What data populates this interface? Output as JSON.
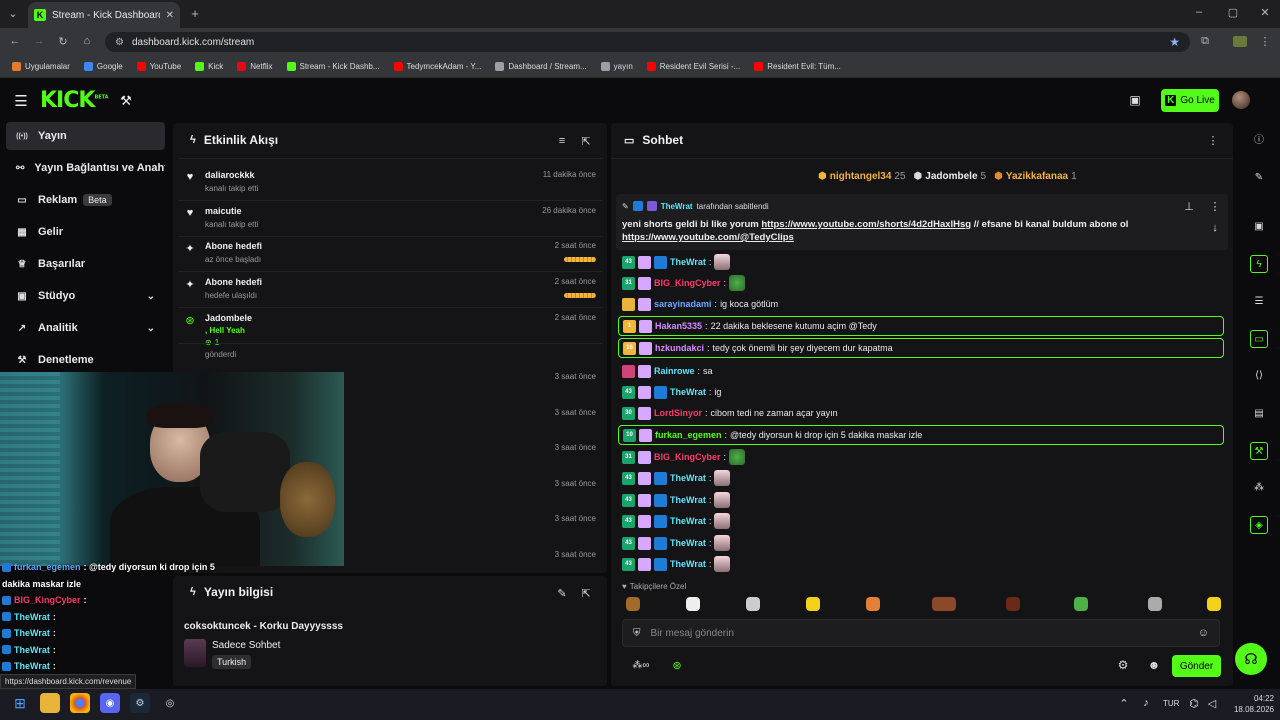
{
  "browser": {
    "tab_title": "Stream - Kick Dashboard",
    "url": "dashboard.kick.com/stream",
    "status_url": "https://dashboard.kick.com/revenue",
    "bookmarks": [
      {
        "label": "Uygulamalar",
        "color": "#e57c2c"
      },
      {
        "label": "Google",
        "color": "#4285f4"
      },
      {
        "label": "YouTube",
        "color": "#ff0000"
      },
      {
        "label": "Kick",
        "color": "#53fc18"
      },
      {
        "label": "Netflix",
        "color": "#e50914"
      },
      {
        "label": "Stream - Kick Dashb...",
        "color": "#53fc18"
      },
      {
        "label": "TedymcekAdam - Y...",
        "color": "#ff0000"
      },
      {
        "label": "Dashboard / Stream...",
        "color": "#9aa0a6"
      },
      {
        "label": "yayın",
        "color": "#9aa0a6"
      },
      {
        "label": "Resident Evil Serisi -...",
        "color": "#ff0000"
      },
      {
        "label": "Resident Evil: Tüm...",
        "color": "#ff0000"
      }
    ]
  },
  "header": {
    "logo": "KICK",
    "logo_sup": "BETA",
    "go_live": "Go Live"
  },
  "sidebar": {
    "items": [
      {
        "label": "Yayın",
        "icon": "broadcast-icon"
      },
      {
        "label": "Yayın Bağlantısı ve Anahtarı",
        "icon": "link-icon"
      },
      {
        "label": "Reklam",
        "icon": "ad-icon",
        "badge": "Beta"
      },
      {
        "label": "Gelir",
        "icon": "revenue-icon"
      },
      {
        "label": "Başarılar",
        "icon": "trophy-icon"
      },
      {
        "label": "Stüdyo",
        "icon": "studio-icon"
      },
      {
        "label": "Analitik",
        "icon": "analytics-icon"
      },
      {
        "label": "Denetleme",
        "icon": "moderation-icon"
      }
    ]
  },
  "activity": {
    "title": "Etkinlik Akışı",
    "items": [
      {
        "who": "daliarockkk",
        "sub": "kanalı takip etti",
        "time": "11 dakika önce"
      },
      {
        "who": "maicutie",
        "sub": "kanalı takip etti",
        "time": "26 dakika önce"
      },
      {
        "who": "Abone hedefi",
        "sub": "az önce başladı",
        "time": "2 saat önce"
      },
      {
        "who": "Abone hedefi",
        "sub": "hedefe ulaşıldı",
        "time": "2 saat önce"
      },
      {
        "who": "Jadombele",
        "sub1": ", Hell Yeah",
        "sub2": "1",
        "sub3": "gönderdi",
        "time": "2 saat önce"
      },
      {
        "time": "3 saat önce"
      },
      {
        "time": "3 saat önce"
      },
      {
        "time": "3 saat önce"
      },
      {
        "time": "3 saat önce"
      },
      {
        "time": "3 saat önce"
      },
      {
        "time": "3 saat önce"
      }
    ]
  },
  "stream_info": {
    "title": "Yayın bilgisi",
    "stream_title": "coksoktuncek - Korku Dayyyssss",
    "mode": "Sadece Sohbet",
    "language": "Turkish"
  },
  "overlay_chat": [
    {
      "user": "furkan_egemen",
      "text": ": @tedy diyorsun ki drop için 5",
      "color": "#5da9ff"
    },
    {
      "user": "",
      "text": "dakika maskar izle",
      "color": "#fff"
    },
    {
      "user": "BIG_KingCyber",
      "text": ":",
      "color": "#ff3b6b"
    },
    {
      "user": "TheWrat",
      "text": ":",
      "color": "#5ee7ff"
    },
    {
      "user": "TheWrat",
      "text": ":",
      "color": "#5ee7ff"
    },
    {
      "user": "TheWrat",
      "text": ":",
      "color": "#5ee7ff"
    },
    {
      "user": "TheWrat",
      "text": ":",
      "color": "#5ee7ff"
    }
  ],
  "chat": {
    "title": "Sohbet",
    "top_gifters": [
      {
        "name": "nightangel34",
        "count": "25"
      },
      {
        "name": "Jadombele",
        "count": "5"
      },
      {
        "name": "Yazikkafanaa",
        "count": "1"
      }
    ],
    "pinned": {
      "pinned_by_user": "TheWrat",
      "pinned_by_text": "tarafından sabitlendi",
      "text": "yeni shorts geldi bi like yorum",
      "link1": "https://www.youtube.com/shorts/4d2dHaxlHsg",
      "mid": " // efsane bi kanal buldum abone ol",
      "link2": "https://www.youtube.com/@TedyClips"
    },
    "messages": [
      {
        "badge": "43",
        "user": "TheWrat",
        "color": "#5ee7ff",
        "text": "",
        "emote": true,
        "hl": false
      },
      {
        "badge": "31",
        "user": "BIG_KingCyber",
        "color": "#ff3b6b",
        "text": "",
        "emote": true,
        "hl": false
      },
      {
        "badge": "",
        "user": "sarayinadami",
        "color": "#6aa8ff",
        "text": "ig koca götlüm",
        "emote": false,
        "hl": false
      },
      {
        "badge": "1",
        "user": "Hakan5335",
        "color": "#d58cff",
        "text": "22 dakika beklesene kutumu açim @Tedy",
        "emote": false,
        "hl": true
      },
      {
        "badge": "16",
        "user": "hzkundakci",
        "color": "#d58cff",
        "text": "tedy çok önemli bir şey diyecem dur kapatma",
        "emote": false,
        "hl": true
      },
      {
        "badge": "",
        "user": "Rainrowe",
        "color": "#5ee7ff",
        "text": "sa",
        "emote": false,
        "hl": false
      },
      {
        "badge": "43",
        "user": "TheWrat",
        "color": "#5ee7ff",
        "text": "ig",
        "emote": false,
        "hl": false
      },
      {
        "badge": "30",
        "user": "LordSinyor",
        "color": "#ff3b6b",
        "text": "cibom tedi ne zaman açar yayın",
        "emote": false,
        "hl": false
      },
      {
        "badge": "10",
        "user": "furkan_egemen",
        "color": "#53fc18",
        "text": "@tedy diyorsun ki drop için 5 dakika maskar izle",
        "emote": false,
        "hl": true
      },
      {
        "badge": "31",
        "user": "BIG_KingCyber",
        "color": "#ff3b6b",
        "text": "",
        "emote": true,
        "hl": false
      },
      {
        "badge": "43",
        "user": "TheWrat",
        "color": "#5ee7ff",
        "text": "",
        "emote": true,
        "hl": false
      },
      {
        "badge": "43",
        "user": "TheWrat",
        "color": "#5ee7ff",
        "text": "",
        "emote": true,
        "hl": false
      },
      {
        "badge": "43",
        "user": "TheWrat",
        "color": "#5ee7ff",
        "text": "",
        "emote": true,
        "hl": false
      },
      {
        "badge": "43",
        "user": "TheWrat",
        "color": "#5ee7ff",
        "text": "",
        "emote": true,
        "hl": false
      },
      {
        "badge": "43",
        "user": "TheWrat",
        "color": "#5ee7ff",
        "text": "",
        "emote": true,
        "hl": false
      }
    ],
    "followers_label": "Takipçilere Özel",
    "input_placeholder": "Bir mesaj gönderin",
    "send": "Gönder"
  },
  "taskbar": {
    "lang": "TUR",
    "time": "04:22",
    "date": "18.08.2026"
  },
  "colors": {
    "accent": "#53fc18",
    "panel": "#141416",
    "bg": "#0b0b0d"
  }
}
